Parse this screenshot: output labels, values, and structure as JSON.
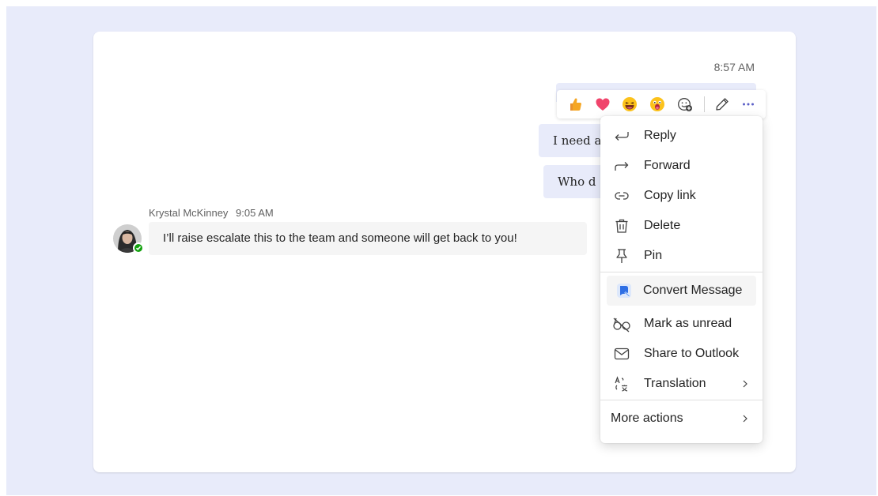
{
  "colors": {
    "backdrop": "#e8ebfa",
    "bubble_self": "#e8ebfa",
    "bubble_other": "#f5f5f5",
    "presence_available": "#13a10e",
    "accent": "#5b5fc7"
  },
  "conversation": {
    "self_timestamp": "8:57 AM",
    "self_messages": [
      {
        "text": "I need a"
      },
      {
        "text": "Who d"
      }
    ],
    "incoming": {
      "sender": "Krystal McKinney",
      "time": "9:05 AM",
      "text": "I’ll raise escalate this to the team and someone will get back to you!"
    }
  },
  "reaction_bar": {
    "reactions": [
      "like-emoji",
      "heart-emoji",
      "laugh-emoji",
      "surprised-emoji",
      "add-reaction-icon"
    ],
    "tools": [
      "edit-pencil-icon",
      "more-options-icon"
    ]
  },
  "context_menu": {
    "group1": [
      {
        "label": "Reply",
        "icon": "reply-icon"
      },
      {
        "label": "Forward",
        "icon": "forward-icon"
      },
      {
        "label": "Copy link",
        "icon": "link-icon"
      },
      {
        "label": "Delete",
        "icon": "trash-icon"
      },
      {
        "label": "Pin",
        "icon": "pin-icon"
      }
    ],
    "convert": {
      "label": "Convert Message",
      "icon": "app-logo-icon"
    },
    "group2": [
      {
        "label": "Mark as unread",
        "icon": "glasses-off-icon"
      },
      {
        "label": "Share to Outlook",
        "icon": "mail-icon"
      },
      {
        "label": "Translation",
        "icon": "translate-icon",
        "submenu": true
      }
    ],
    "more_actions": {
      "label": "More actions",
      "submenu": true
    }
  }
}
